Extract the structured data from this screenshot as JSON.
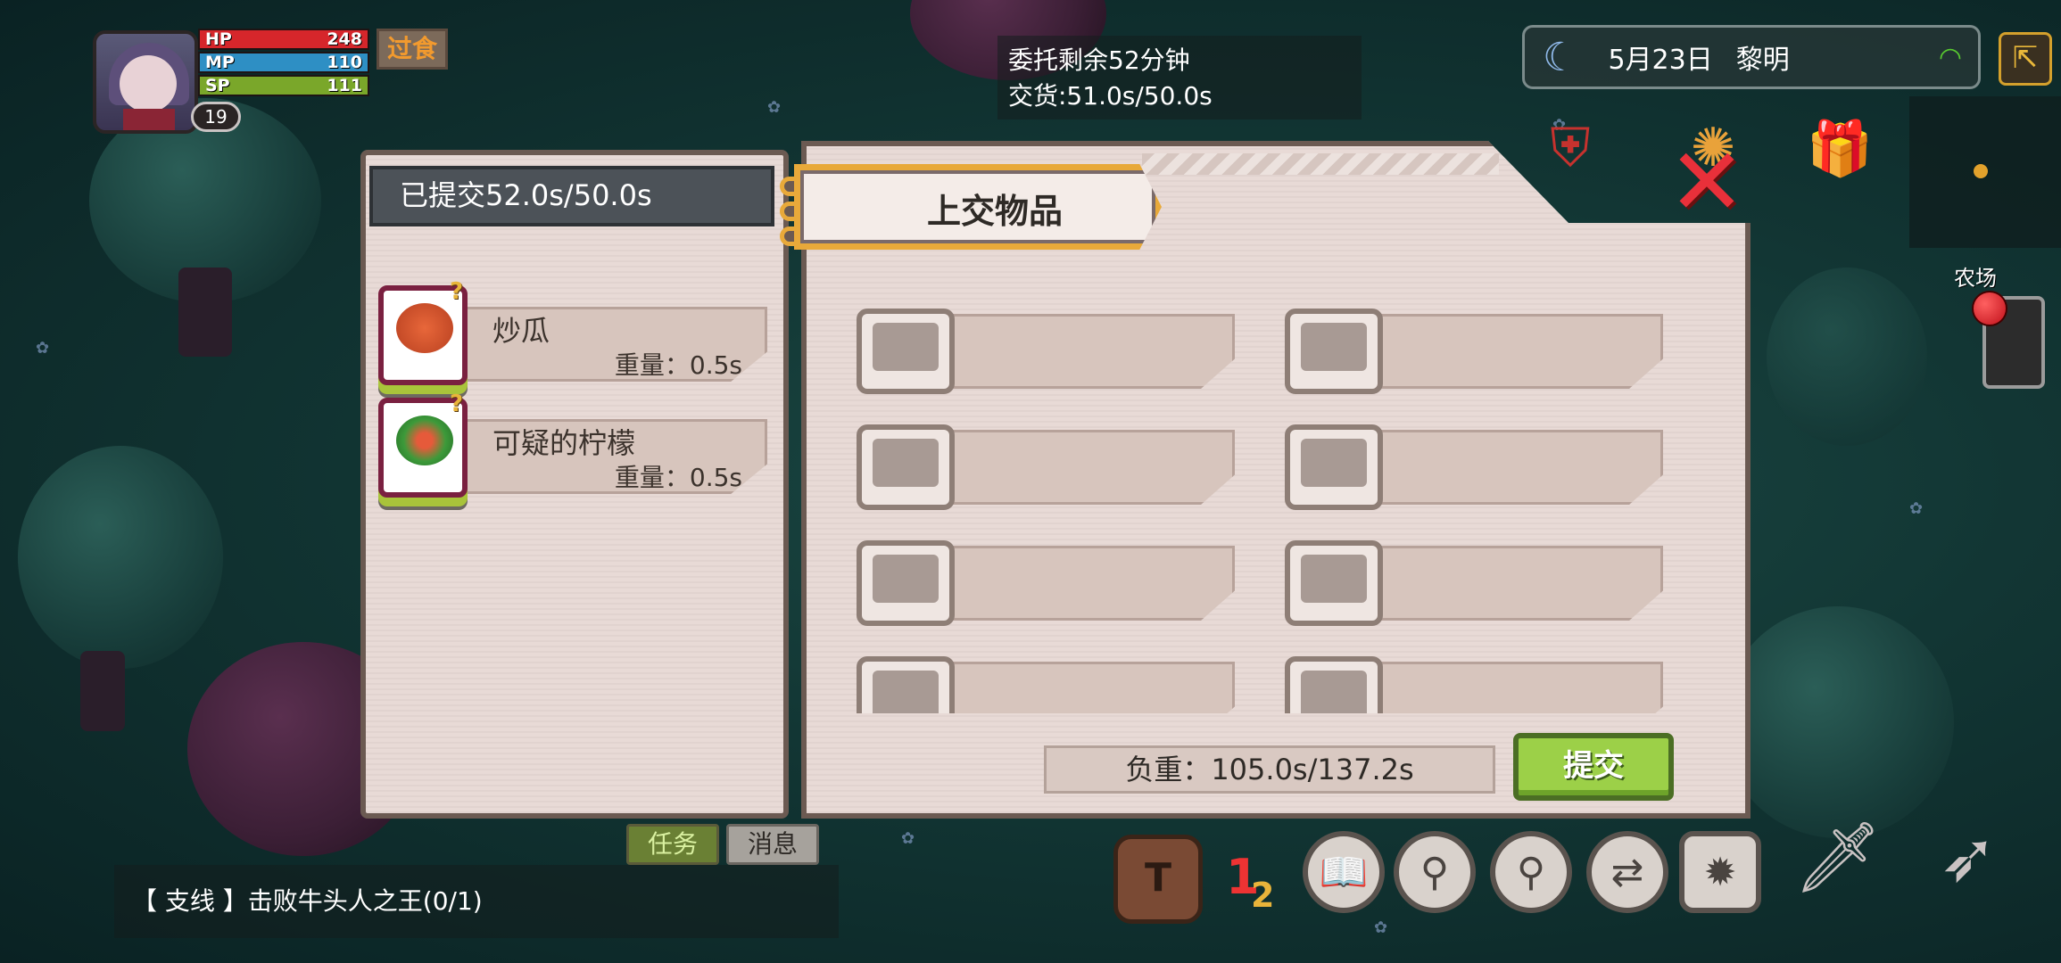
{
  "player": {
    "hp_label": "HP",
    "hp_value": "248",
    "mp_label": "MP",
    "mp_value": "110",
    "sp_label": "SP",
    "sp_value": "111",
    "level": "19",
    "status": "过食"
  },
  "commission": {
    "time_left": "委托剩余52分钟",
    "delivery": "交货:51.0s/50.0s"
  },
  "header": {
    "date": "5月23日",
    "time_of_day": "黎明"
  },
  "map": {
    "label": "农场"
  },
  "left_panel": {
    "submitted": "已提交52.0s/50.0s",
    "items": [
      {
        "name": "炒瓜",
        "weight": "重量：0.5s",
        "badge": "?"
      },
      {
        "name": "可疑的柠檬",
        "weight": "重量：0.5s",
        "badge": "?"
      }
    ]
  },
  "main_panel": {
    "title": "上交物品",
    "slot_count": 8,
    "load": "负重：105.0s/137.2s",
    "submit_label": "提交"
  },
  "bottom": {
    "tab_task": "任务",
    "tab_message": "消息",
    "quest": "【 支线 】击败牛头人之王(0/1)",
    "page_primary": "1",
    "page_secondary": "2",
    "backpack_glyph": "T"
  },
  "colors": {
    "hp": "#d6262b",
    "mp": "#2e8fc4",
    "sp": "#7aa72a",
    "accent_gold": "#e8a93a",
    "submit_green": "#9cd048",
    "close_red": "#e9303a"
  },
  "icons": [
    "moon-icon",
    "wifi-icon",
    "exit-icon",
    "guild-emblem-icon",
    "sun-crown-icon",
    "gift-icon",
    "close-icon",
    "book-icon",
    "magnifier-icon",
    "search-icon",
    "swap-icon",
    "skill-icon",
    "sword-icon",
    "bow-icon"
  ]
}
